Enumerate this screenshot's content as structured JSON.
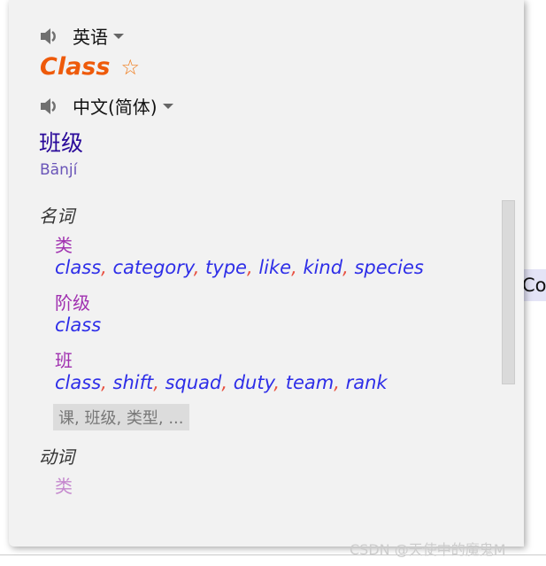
{
  "background": {
    "fragment_text": "Co",
    "watermark": "CSDN @天使中的魔鬼M"
  },
  "popup": {
    "source_lang": "英语",
    "word": "Class",
    "target_lang": "中文(简体)",
    "translation": "班级",
    "pinyin": "Bānjí",
    "sections": [
      {
        "pos": "名词",
        "senses": [
          {
            "zh": "类",
            "en": [
              "class",
              "category",
              "type",
              "like",
              "kind",
              "species"
            ]
          },
          {
            "zh": "阶级",
            "en": [
              "class"
            ]
          },
          {
            "zh": "班",
            "en": [
              "class",
              "shift",
              "squad",
              "duty",
              "team",
              "rank"
            ]
          }
        ],
        "more": "课, 班级, 类型, ..."
      },
      {
        "pos": "动词",
        "senses": [
          {
            "zh": "类",
            "en": []
          }
        ]
      }
    ]
  },
  "colors": {
    "word": "#ee5a0a",
    "translation": "#2a0a9a",
    "sense_zh": "#a030b0",
    "sense_en": "#2e2ee8",
    "comma": "#e85040"
  }
}
